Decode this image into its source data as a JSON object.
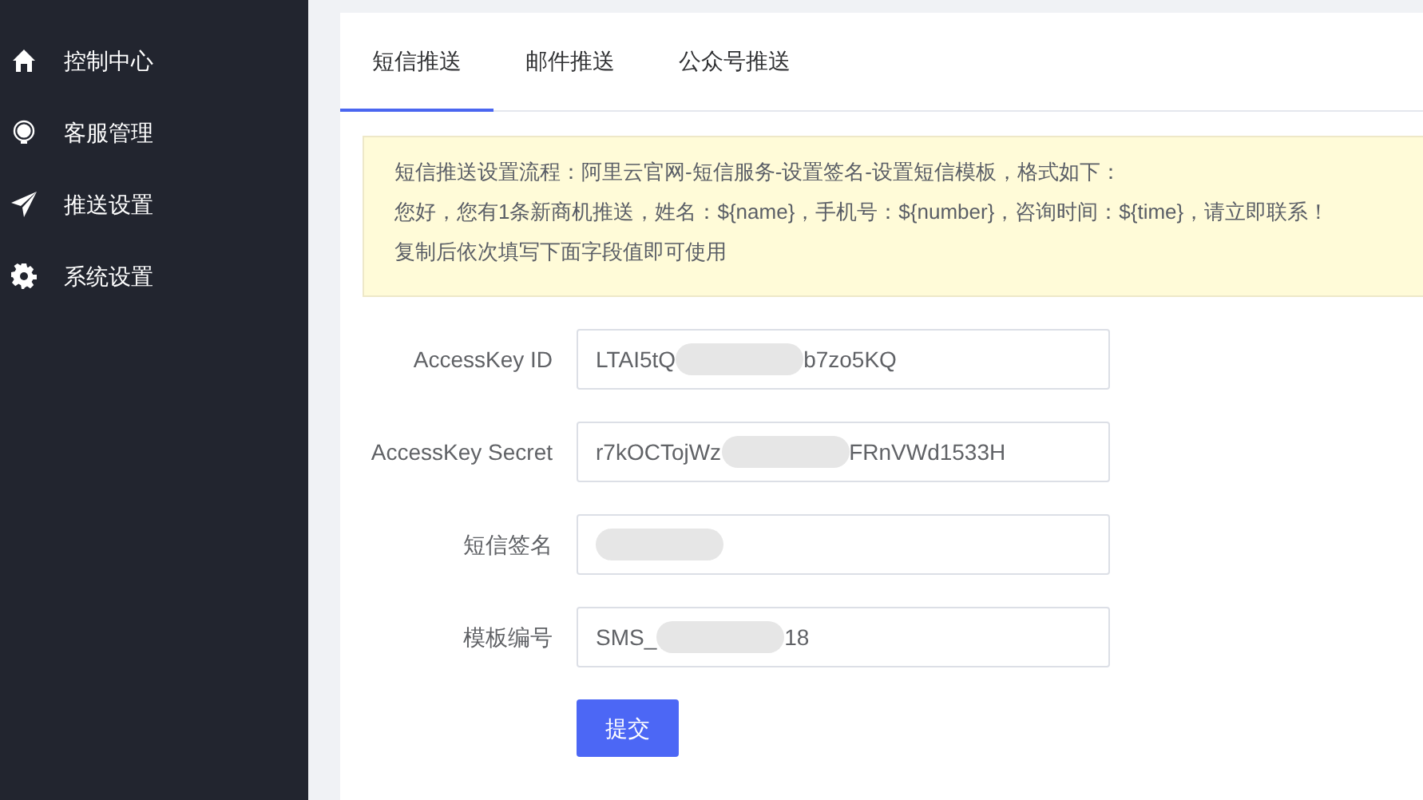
{
  "sidebar": {
    "items": [
      {
        "kind": "home",
        "label": "控制中心"
      },
      {
        "kind": "bulb",
        "label": "客服管理"
      },
      {
        "kind": "send",
        "label": "推送设置"
      },
      {
        "kind": "gear",
        "label": "系统设置"
      }
    ]
  },
  "tabs": [
    {
      "label": "短信推送",
      "selected": true
    },
    {
      "label": "邮件推送",
      "selected": false
    },
    {
      "label": "公众号推送",
      "selected": false
    }
  ],
  "notice": {
    "lines": [
      "短信推送设置流程：阿里云官网-短信服务-设置签名-设置短信模板，格式如下：",
      "您好，您有1条新商机推送，姓名：${name}，手机号：${number}，咨询时间：${time}，请立即联系！",
      "复制后依次填写下面字段值即可使用"
    ]
  },
  "form": {
    "fields": [
      {
        "label": "AccessKey ID",
        "value_parts": [
          "LTAI5tQ",
          "b7zo5KQ"
        ],
        "redacted": true
      },
      {
        "label": "AccessKey Secret",
        "value_parts": [
          "r7kOCTojWz",
          "FRnVWd1533H"
        ],
        "redacted": true
      },
      {
        "label": "短信签名",
        "redacted": true
      },
      {
        "label": "模板编号",
        "value_parts": [
          "SMS_",
          "18"
        ],
        "redacted": true
      }
    ],
    "submit": "提交"
  }
}
